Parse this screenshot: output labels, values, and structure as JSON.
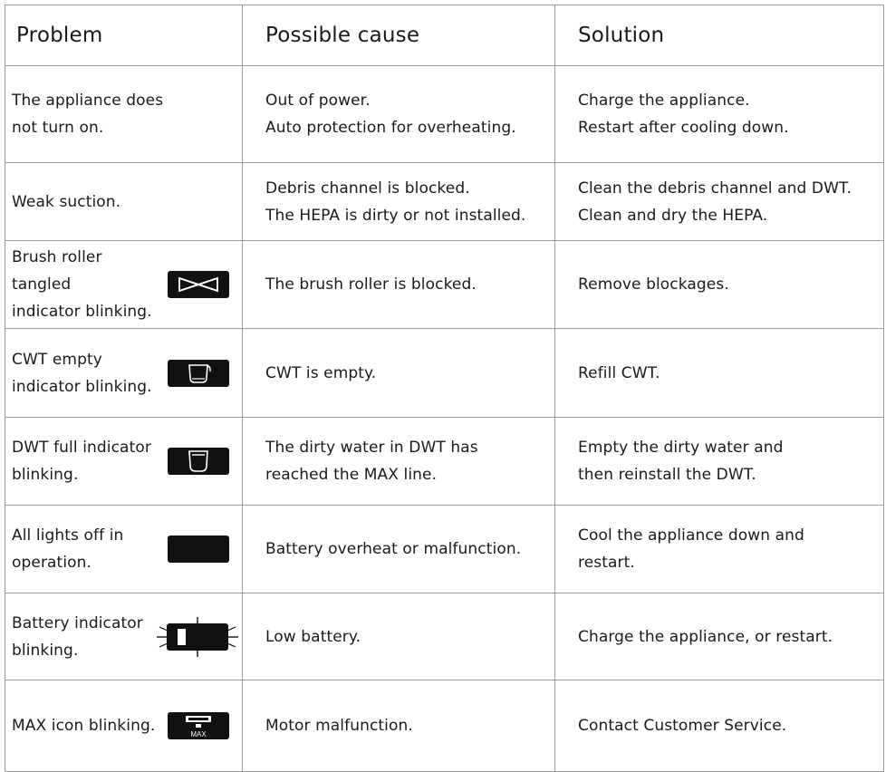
{
  "headers": {
    "problem": "Problem",
    "cause": "Possible cause",
    "solution": "Solution"
  },
  "rows": [
    {
      "problem": [
        "The appliance does",
        "not turn on."
      ],
      "cause": [
        "Out of power.",
        "Auto protection for overheating."
      ],
      "solution": [
        "Charge the appliance.",
        "Restart after cooling down."
      ],
      "icon": ""
    },
    {
      "problem": [
        "Weak suction."
      ],
      "cause": [
        "Debris channel is blocked.",
        "The HEPA is dirty or not installed."
      ],
      "solution": [
        "Clean the debris channel and DWT.",
        "Clean and dry the HEPA."
      ],
      "icon": ""
    },
    {
      "problem": [
        "Brush roller tangled",
        "indicator blinking."
      ],
      "cause": [
        "The brush roller is blocked."
      ],
      "solution": [
        "Remove blockages."
      ],
      "icon": "brush-roller-tangled-icon"
    },
    {
      "problem": [
        "CWT empty",
        "indicator blinking."
      ],
      "cause": [
        "CWT is empty."
      ],
      "solution": [
        "Refill CWT."
      ],
      "icon": "clean-water-tank-icon"
    },
    {
      "problem": [
        "DWT full indicator",
        "blinking."
      ],
      "cause": [
        "The dirty water in DWT has",
        "reached the MAX line."
      ],
      "solution": [
        "Empty the dirty water and",
        "then reinstall the DWT."
      ],
      "icon": "dirty-water-tank-icon"
    },
    {
      "problem": [
        "All lights off in",
        "operation."
      ],
      "cause": [
        "Battery overheat or malfunction."
      ],
      "solution": [
        "Cool the appliance down and",
        "restart."
      ],
      "icon": "all-lights-off-icon"
    },
    {
      "problem": [
        "Battery indicator",
        "blinking."
      ],
      "cause": [
        "Low battery."
      ],
      "solution": [
        "Charge the appliance, or restart."
      ],
      "icon": "battery-blinking-icon"
    },
    {
      "problem": [
        "MAX icon blinking."
      ],
      "cause": [
        "Motor malfunction."
      ],
      "solution": [
        "Contact Customer Service."
      ],
      "icon": "max-mode-icon"
    }
  ],
  "max_icon_label": "MAX",
  "colors": {
    "border": "#9a9a9a",
    "text": "#1a1a1a",
    "indicator": "#111111"
  }
}
